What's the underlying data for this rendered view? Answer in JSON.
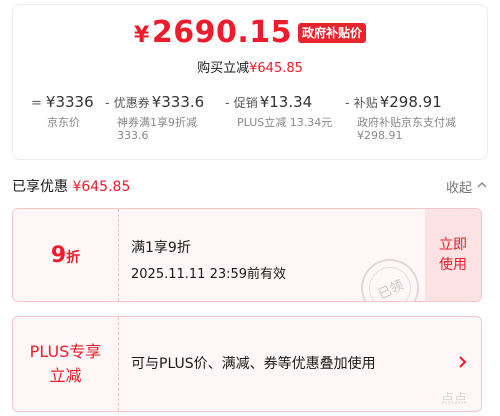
{
  "price_card": {
    "currency": "¥",
    "final_price": "2690.15",
    "gov_badge": "政府补贴价",
    "buy_prefix": "购买立减",
    "buy_amount": "¥645.85",
    "breakdown": [
      {
        "op": "=",
        "label": "",
        "amount": "¥3336",
        "sub": "京东价"
      },
      {
        "op": "-",
        "label": "优惠券",
        "amount": "¥333.6",
        "sub": "神券满1享9折减333.6"
      },
      {
        "op": "-",
        "label": "促销",
        "amount": "¥13.34",
        "sub": "PLUS立减 13.34元"
      },
      {
        "op": "-",
        "label": "补贴",
        "amount": "¥298.91",
        "sub": "政府补贴京东支付减¥298.91"
      }
    ]
  },
  "summary": {
    "label": "已享优惠",
    "amount": "¥645.85",
    "collapse_label": "收起",
    "collapse_icon": "chevron-up-icon"
  },
  "coupon": {
    "discount_value": "9",
    "discount_unit": "折",
    "title": "满1享9折",
    "validity": "2025.11.11 23:59前有效",
    "action_line1": "立即",
    "action_line2": "使用",
    "stamp_text": "已领"
  },
  "plus_card": {
    "title_line1": "PLUS专享",
    "title_line2": "立减",
    "description": "可与PLUS价、满减、券等优惠叠加使用",
    "arrow_icon": "chevron-right-icon"
  },
  "watermark": "点点",
  "colors": {
    "accent": "#ef1b2a",
    "badge": "#e8242e",
    "card_bg": "#fff7f7",
    "action_bg": "#fde2e4"
  }
}
